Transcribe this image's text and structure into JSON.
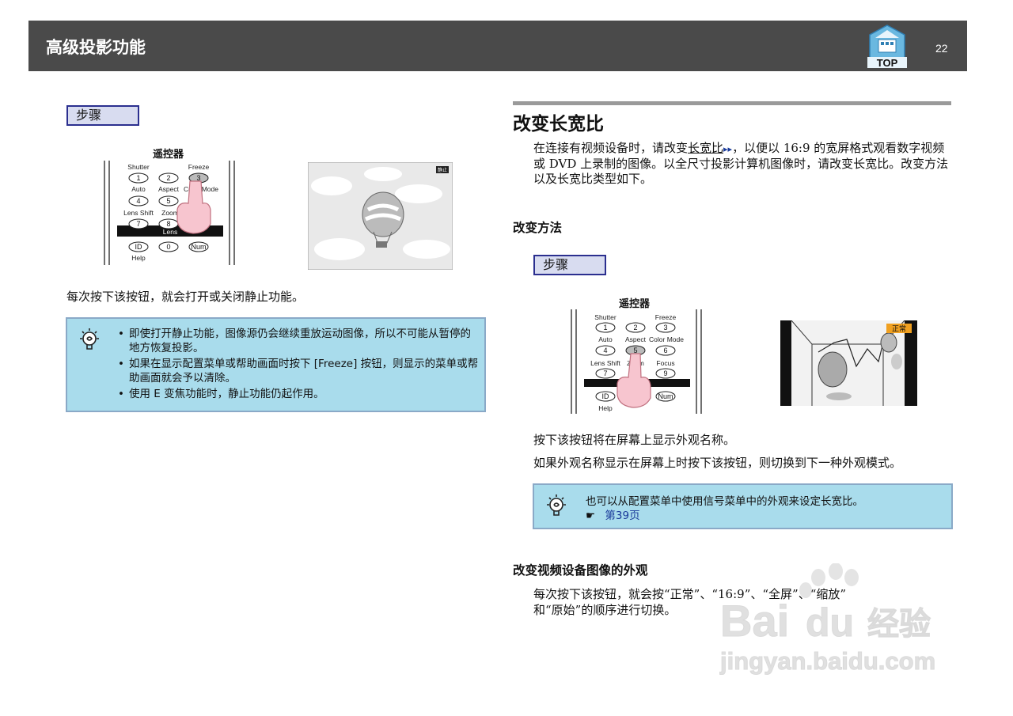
{
  "header": {
    "title": "高级投影功能",
    "top_label": "TOP",
    "page_number": "22"
  },
  "left": {
    "step_label": "步骤",
    "remote": {
      "title": "遥控器",
      "labels": [
        "Shutter",
        "Freeze",
        "Auto",
        "Aspect",
        "Color Mode",
        "Lens Shift",
        "Zoom",
        "Lens",
        "Help"
      ],
      "keys": [
        "1",
        "2",
        "3",
        "4",
        "5",
        "7",
        "8",
        "ID",
        "0",
        "Num"
      ]
    },
    "screen_badge": "静止",
    "description": "每次按下该按钮，就会打开或关闭静止功能。",
    "tips": [
      "即使打开静止功能，图像源仍会继续重放运动图像，所以不可能从暂停的地方恢复投影。",
      "如果在显示配置菜单或帮助画面时按下 [Freeze] 按钮，则显示的菜单或帮助画面就会予以清除。",
      "使用 E 变焦功能时，静止功能仍起作用。"
    ]
  },
  "right": {
    "section_title": "改变长宽比",
    "intro_before": "在连接有视频设备时，请改变",
    "intro_link": "长宽比",
    "intro_link_mark": "▸▸",
    "intro_after": "，以便以 16:9 的宽屏格式观看数字视频或 DVD 上录制的图像。以全尺寸投影计算机图像时，请改变长宽比。改变方法以及长宽比类型如下。",
    "method_heading": "改变方法",
    "step_label": "步骤",
    "remote": {
      "title": "遥控器",
      "labels": [
        "Shutter",
        "Freeze",
        "Auto",
        "Aspect",
        "Color Mode",
        "Lens Shift",
        "Zoom",
        "Focus",
        "Help"
      ],
      "keys": [
        "1",
        "2",
        "3",
        "4",
        "5",
        "6",
        "7",
        "9",
        "ID",
        "Num"
      ]
    },
    "screen_badge": "正常",
    "line1": "按下该按钮将在屏幕上显示外观名称。",
    "line2": "如果外观名称显示在屏幕上时按下该按钮，则切换到下一种外观模式。",
    "tip_text": "也可以从配置菜单中使用信号菜单中的外观来设定长宽比。",
    "tip_ref_icon": "☛",
    "tip_ref": "第39页",
    "video_heading": "改变视频设备图像的外观",
    "video_text_1": "每次按下该按钮，就会按“正常”、“16:9”、“全屏”、“缩放”",
    "video_text_2": "和“原始”的顺序进行切换。"
  },
  "watermark": {
    "brand": "Bai",
    "brand2": "du",
    "suffix": "经验",
    "url": "jingyan.baidu.com"
  }
}
